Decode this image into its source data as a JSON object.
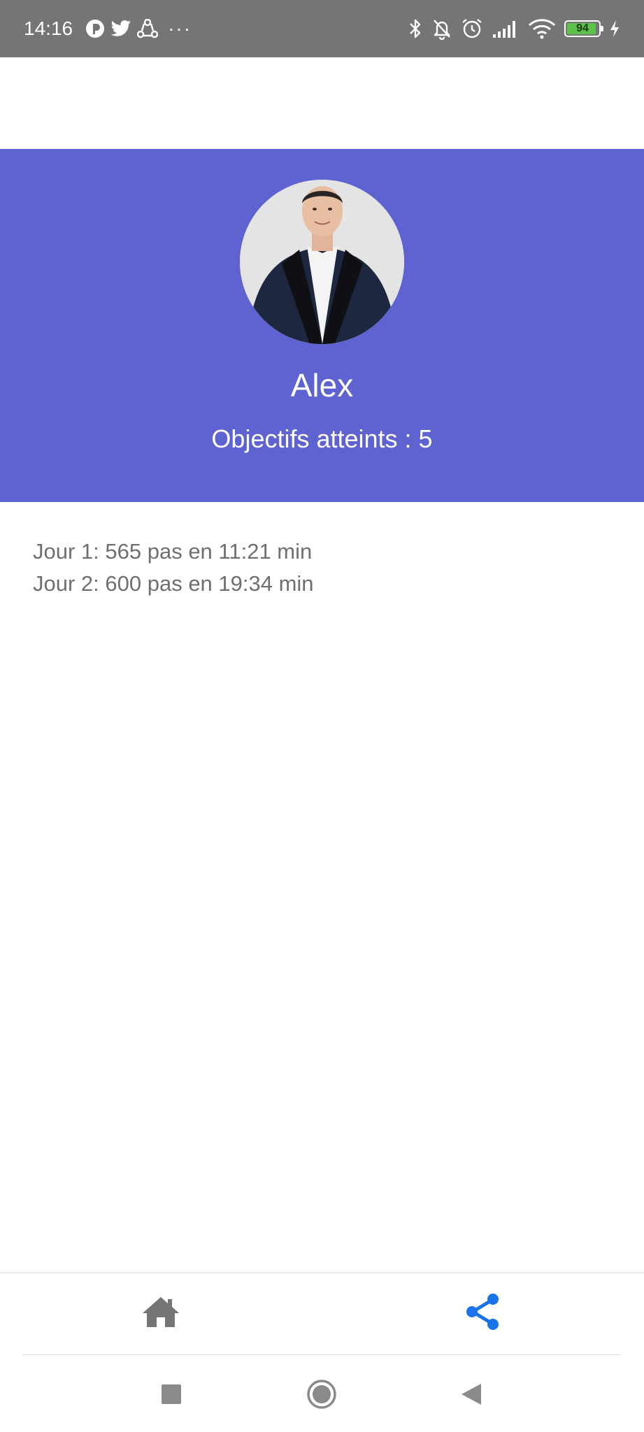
{
  "status_bar": {
    "time": "14:16",
    "battery_level": 94,
    "battery_label": "94",
    "left_icons": [
      "app-icon",
      "twitter-icon",
      "sync-icon"
    ],
    "more_indicator": "···",
    "right_icons": [
      "bluetooth-icon",
      "bell-off-icon",
      "alarm-icon",
      "signal-icon",
      "wifi-icon",
      "battery-icon",
      "charging-icon"
    ]
  },
  "profile": {
    "name": "Alex",
    "goals_text": "Objectifs atteints : 5"
  },
  "stats": [
    {
      "text": "Jour 1: 565 pas en 11:21 min"
    },
    {
      "text": "Jour 2: 600 pas en 19:34 min"
    }
  ],
  "tab_bar": {
    "tabs": [
      {
        "icon": "home-icon",
        "active": false
      },
      {
        "icon": "share-icon",
        "active": true
      }
    ]
  },
  "system_nav": {
    "buttons": [
      "recents-icon",
      "home-circle-icon",
      "back-icon"
    ]
  },
  "colors": {
    "header_background": "#5e63d1",
    "status_bar": "#757575",
    "active_tab": "#1a73e8",
    "inactive_tab": "#757575",
    "stat_text": "#6f6f6f",
    "battery_fill": "#5cc24a"
  }
}
